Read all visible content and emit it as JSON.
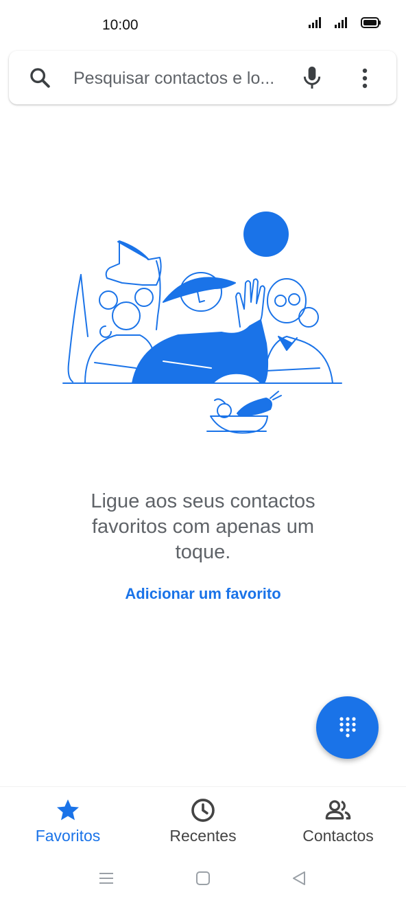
{
  "status_bar": {
    "time": "10:00"
  },
  "search": {
    "placeholder": "Pesquisar contactos e lo..."
  },
  "empty_state": {
    "message": "Ligue aos seus contactos favoritos com apenas um toque.",
    "action": "Adicionar um favorito"
  },
  "bottom_nav": [
    {
      "label": "Favoritos",
      "icon": "star-icon",
      "active": true
    },
    {
      "label": "Recentes",
      "icon": "clock-icon",
      "active": false
    },
    {
      "label": "Contactos",
      "icon": "people-icon",
      "active": false
    }
  ],
  "colors": {
    "accent": "#1a73e8",
    "text_secondary": "#5f6368"
  }
}
